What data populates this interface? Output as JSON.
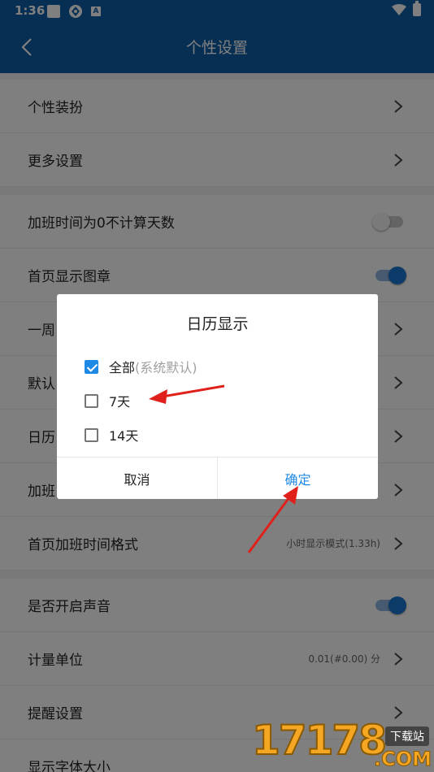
{
  "statusbar": {
    "time": "1:36"
  },
  "appbar": {
    "title": "个性设置"
  },
  "settings": {
    "group1": [
      {
        "label": "个性装扮"
      },
      {
        "label": "更多设置"
      }
    ],
    "group2": [
      {
        "label": "加班时间为0不计算天数",
        "toggle": "off"
      },
      {
        "label": "首页显示图章",
        "toggle": "on"
      },
      {
        "label": "一周"
      },
      {
        "label": "默认"
      },
      {
        "label": "日历"
      },
      {
        "label": "加班"
      },
      {
        "label": "首页加班时间格式",
        "value": "小时显示模式(1.33h)"
      }
    ],
    "group3": [
      {
        "label": "是否开启声音",
        "toggle": "on"
      },
      {
        "label": "计量单位",
        "value": "0.01(#0.00) 分"
      },
      {
        "label": "提醒设置"
      },
      {
        "label": "显示字体大小"
      }
    ]
  },
  "dialog": {
    "title": "日历显示",
    "options": [
      {
        "label": "全部",
        "hint": "(系统默认)",
        "checked": true
      },
      {
        "label": "7天",
        "hint": "",
        "checked": false
      },
      {
        "label": "14天",
        "hint": "",
        "checked": false
      }
    ],
    "cancel_label": "取消",
    "ok_label": "确定"
  },
  "watermark": {
    "text": "17178",
    "badge": "下载站",
    "domain": ".COM"
  },
  "colors": {
    "primary": "#0e5ea8",
    "accent": "#1e88e5",
    "arrow": "#e0201b"
  },
  "icons": [
    "back-arrow-icon",
    "chevron-right-icon",
    "wifi-icon",
    "battery-icon",
    "checkbox-icon"
  ]
}
